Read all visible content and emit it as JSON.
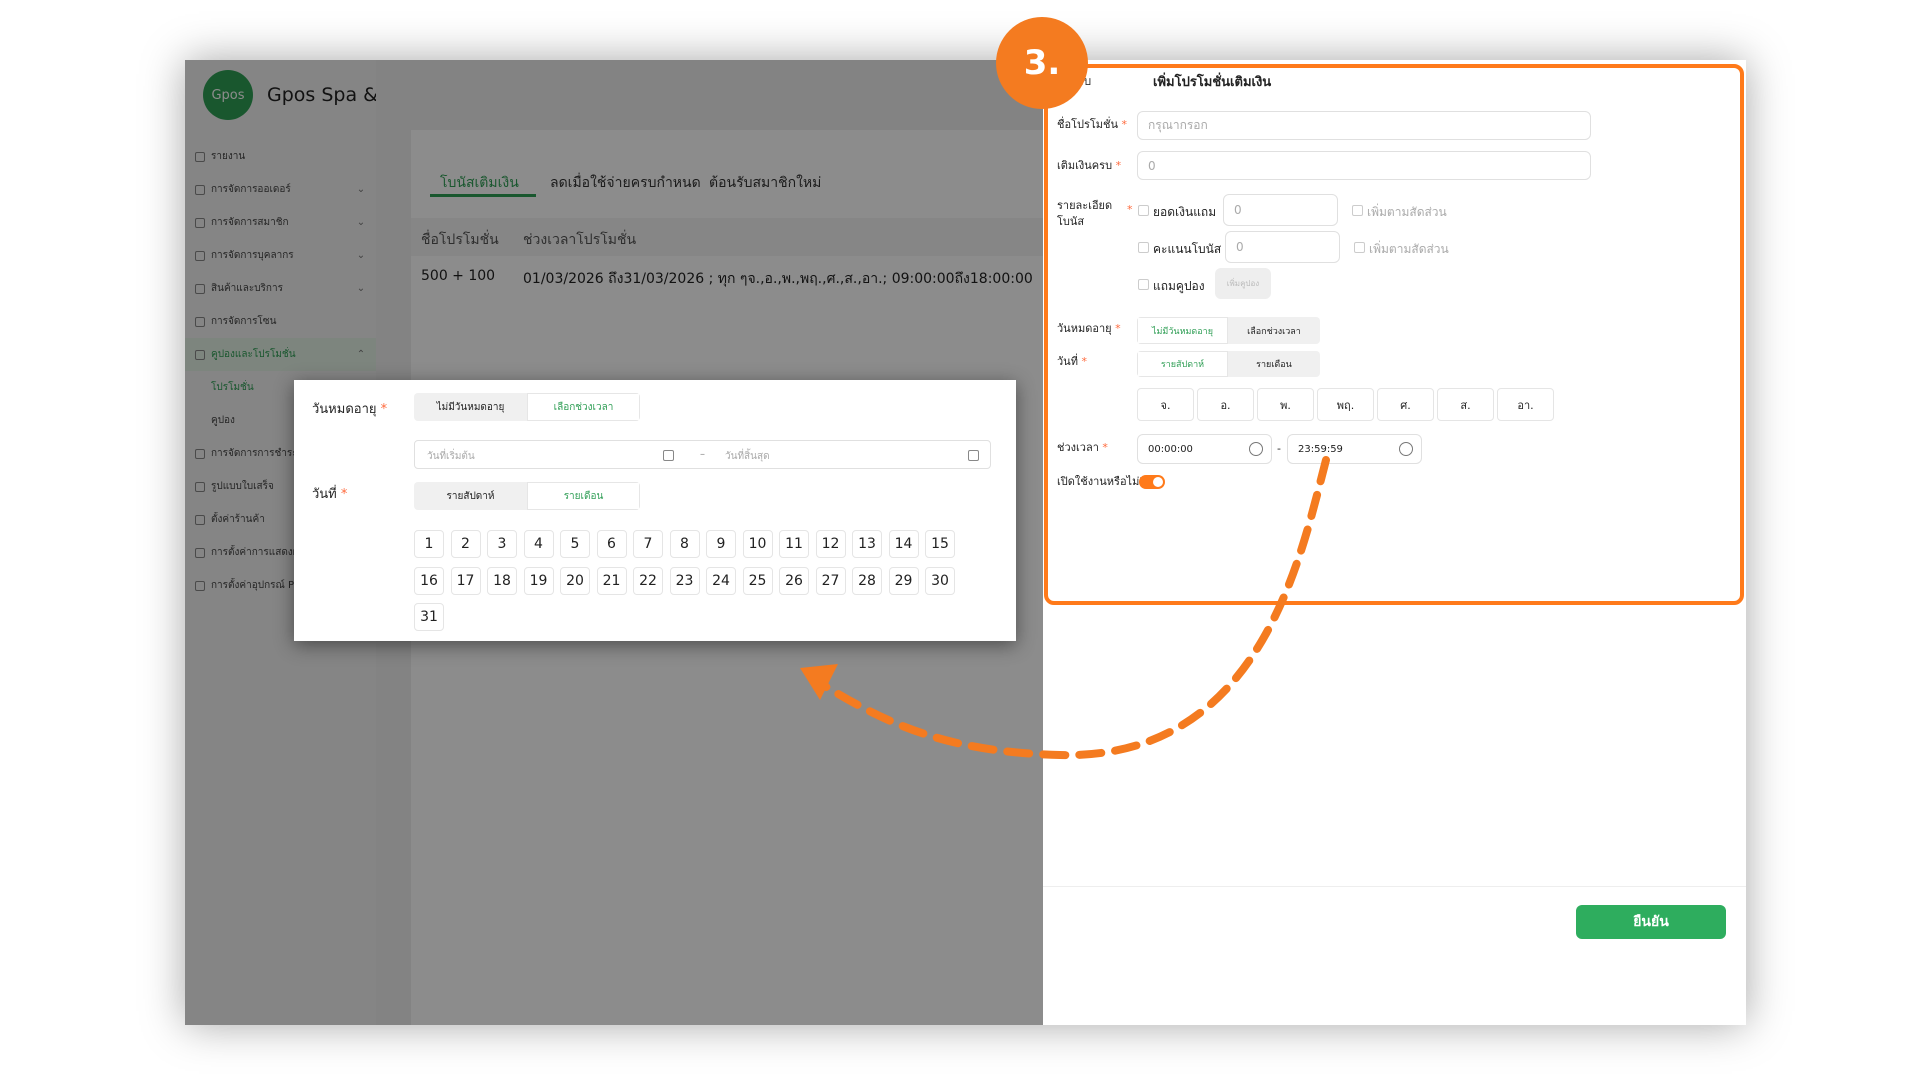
{
  "brand": {
    "logo_text": "Gpos",
    "name": "Gpos Spa & Massage"
  },
  "sidebar": {
    "items": [
      {
        "label": "รายงาน",
        "chevron": ""
      },
      {
        "label": "การจัดการออเดอร์",
        "chevron": "⌄"
      },
      {
        "label": "การจัดการสมาชิก",
        "chevron": "⌄"
      },
      {
        "label": "การจัดการบุคลากร",
        "chevron": "⌄"
      },
      {
        "label": "สินค้าและบริการ",
        "chevron": "⌄"
      },
      {
        "label": "การจัดการโซน",
        "chevron": ""
      },
      {
        "label": "คูปองและโปรโมชั่น",
        "chevron": "⌃"
      },
      {
        "label": "โปรโมชั่น",
        "chevron": ""
      },
      {
        "label": "คูปอง",
        "chevron": ""
      },
      {
        "label": "การจัดการการชำระเงิน",
        "chevron": ""
      },
      {
        "label": "รูปแบบใบเสร็จ",
        "chevron": ""
      },
      {
        "label": "ตั้งค่าร้านค้า",
        "chevron": ""
      },
      {
        "label": "การตั้งค่าการแสดงผล",
        "chevron": ""
      },
      {
        "label": "การตั้งค่าอุปกรณ์ POS",
        "chevron": ""
      }
    ]
  },
  "tabs": [
    "โบนัสเติมเงิน",
    "ลดเมื่อใช้จ่ายครบกำหนด",
    "ต้อนรับสมาชิกใหม่"
  ],
  "table": {
    "headers": [
      "ชื่อโปรโมชั่น",
      "ช่วงเวลาโปรโมชั่น"
    ],
    "row": {
      "name": "500 + 100",
      "period": "01/03/2026 ถึง31/03/2026 ; ทุก ๆจ.,อ.,พ.,พฤ.,ศ.,ส.,อา.; 09:00:00ถึง18:00:00"
    }
  },
  "drawer": {
    "back": "กลับ",
    "title": "เพิ่มโปรโมชั่นเติมเงิน",
    "promo_name_label": "ชื่อโปรโมชั่น",
    "promo_name_placeholder": "กรุณากรอก",
    "topup_label": "เติมเงินครบ",
    "topup_value": "0",
    "bonus_label_1": "รายละเอียด",
    "bonus_label_2": "โบนัส",
    "bonus_amount_label": "ยอดเงินแถม",
    "bonus_amount_value": "0",
    "bonus_points_label": "คะแนนโบนัส",
    "bonus_points_value": "0",
    "proportional_label": "เพิ่มตามสัดส่วน",
    "coupon_label": "แถมคูปอง",
    "add_coupon_button": "เพิ่มคูปอง",
    "expiry_label": "วันหมดอายุ",
    "expiry_options": [
      "ไม่มีวันหมดอายุ",
      "เลือกช่วงเวลา"
    ],
    "date_label": "วันที่",
    "date_options": [
      "รายสัปดาห์",
      "รายเดือน"
    ],
    "weekdays": [
      "จ.",
      "อ.",
      "พ.",
      "พฤ.",
      "ศ.",
      "ส.",
      "อา."
    ],
    "time_label": "ช่วงเวลา",
    "time_start": "00:00:00",
    "time_end": "23:59:59",
    "time_sep": "-",
    "enable_label": "เปิดใช้งานหรือไม่?",
    "enabled": true,
    "confirm_button": "ยืนยัน"
  },
  "zoom": {
    "expiry_label": "วันหมดอายุ",
    "expiry_options": [
      "ไม่มีวันหมดอายุ",
      "เลือกช่วงเวลา"
    ],
    "start_placeholder": "วันที่เริ่มต้น",
    "end_placeholder": "วันที่สิ้นสุด",
    "range_sep": "–",
    "date_label": "วันที่",
    "date_options": [
      "รายสัปดาห์",
      "รายเดือน"
    ],
    "days": [
      "1",
      "2",
      "3",
      "4",
      "5",
      "6",
      "7",
      "8",
      "9",
      "10",
      "11",
      "12",
      "13",
      "14",
      "15",
      "16",
      "17",
      "18",
      "19",
      "20",
      "21",
      "22",
      "23",
      "24",
      "25",
      "26",
      "27",
      "28",
      "29",
      "30",
      "31"
    ]
  },
  "step_badge": "3.",
  "colors": {
    "accent_green": "#2f9e55",
    "highlight_orange": "#ff7a1a",
    "required_star": "#ff6a3d"
  }
}
